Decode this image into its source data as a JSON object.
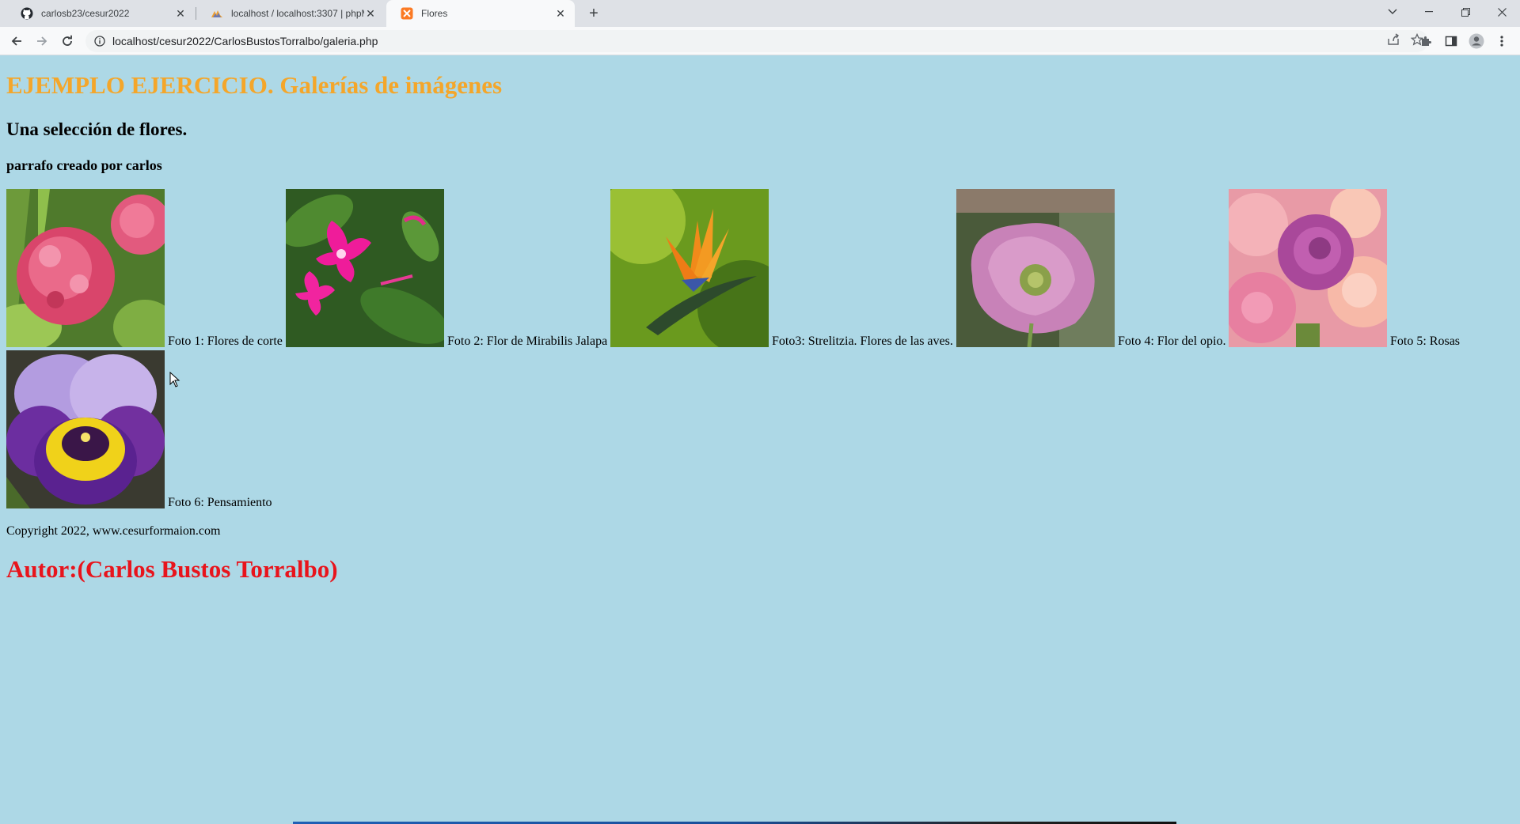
{
  "browser": {
    "tabs": [
      {
        "title": "carlosb23/cesur2022",
        "icon": "github-icon"
      },
      {
        "title": "localhost / localhost:3307 | phpM",
        "icon": "phpmyadmin-icon"
      },
      {
        "title": "Flores",
        "icon": "xampp-icon",
        "active": true
      }
    ],
    "url": "localhost/cesur2022/CarlosBustosTorralbo/galeria.php"
  },
  "page": {
    "heading": "EJEMPLO EJERCICIO. Galerías de imágenes",
    "subheading": "Una selección de flores.",
    "paragraph": "parrafo creado por carlos",
    "gallery": [
      {
        "caption": "Foto 1: Flores de corte",
        "subject": "pink hydrangea"
      },
      {
        "caption": "Foto 2: Flor de Mirabilis Jalapa",
        "subject": "magenta mirabilis flower"
      },
      {
        "caption": "Foto3: Strelitzia. Flores de las aves.",
        "subject": "bird of paradise flower"
      },
      {
        "caption": "Foto 4: Flor del opio.",
        "subject": "pink poppy"
      },
      {
        "caption": "Foto 5: Rosas",
        "subject": "pink and purple roses"
      },
      {
        "caption": "Foto 6: Pensamiento",
        "subject": "purple and yellow pansy"
      }
    ],
    "copyright": "Copyright 2022, www.cesurformaion.com",
    "author": "Autor:(Carlos Bustos Torralbo)"
  },
  "colors": {
    "page_background": "#add8e6",
    "heading": "#f4a62a",
    "author": "#e8141c"
  }
}
